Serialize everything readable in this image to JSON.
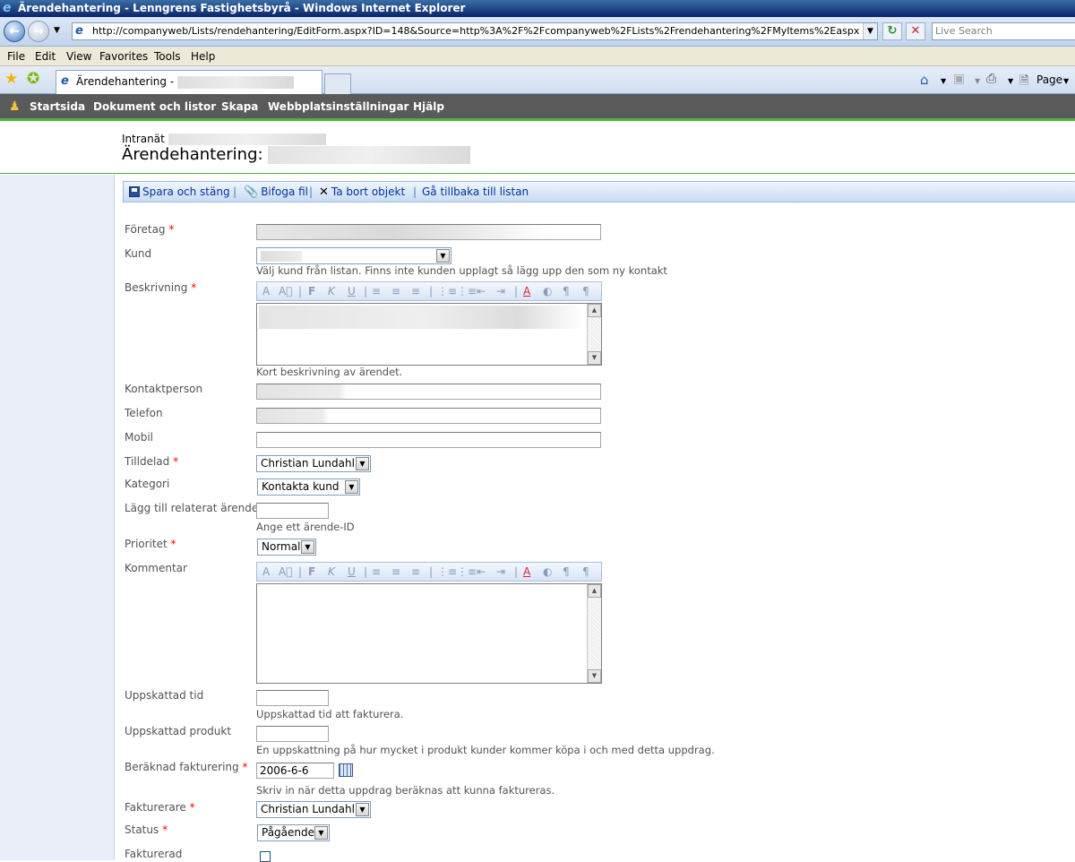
{
  "window": {
    "title": "Ärendehantering - Lenngrens Fastighetsbyrå - Windows Internet Explorer",
    "url": "http://companyweb/Lists/rendehantering/EditForm.aspx?ID=148&Source=http%3A%2F%2Fcompanyweb%2FLists%2Frendehantering%2FMyItems%2Easpx",
    "search_placeholder": "Live Search"
  },
  "menu": [
    "File",
    "Edit",
    "View",
    "Favorites",
    "Tools",
    "Help"
  ],
  "tab": {
    "label": "Ärendehantering -"
  },
  "commandbar": {
    "page_label": "Page"
  },
  "topnav": [
    "Startsida",
    "Dokument och listor",
    "Skapa",
    "Webbplatsinställningar",
    "Hjälp"
  ],
  "header": {
    "breadcrumb": "Intranät",
    "title": "Ärendehantering:"
  },
  "toolbar": {
    "save": "Spara och stäng",
    "attach": "Bifoga fil",
    "delete": "Ta bort objekt",
    "back": "Gå tillbaka till listan",
    "sep": "|"
  },
  "form": {
    "required_mark": "*",
    "foretag": {
      "label": "Företag"
    },
    "kund": {
      "label": "Kund",
      "hint": "Välj kund från listan. Finns inte kunden upplagt så lägg upp den som ny kontakt"
    },
    "beskrivning": {
      "label": "Beskrivning",
      "hint": "Kort beskrivning av ärendet."
    },
    "kontaktperson": {
      "label": "Kontaktperson"
    },
    "telefon": {
      "label": "Telefon"
    },
    "mobil": {
      "label": "Mobil",
      "value": ""
    },
    "tilldelad": {
      "label": "Tilldelad",
      "value": "Christian Lundahl"
    },
    "kategori": {
      "label": "Kategori",
      "value": "Kontakta kund"
    },
    "relaterat": {
      "label": "Lägg till relaterat ärende",
      "value": "",
      "hint": "Ange ett ärende-ID"
    },
    "prioritet": {
      "label": "Prioritet",
      "value": "Normal"
    },
    "kommentar": {
      "label": "Kommentar"
    },
    "uppskattad_tid": {
      "label": "Uppskattad tid",
      "value": "",
      "hint": "Uppskattad tid att fakturera."
    },
    "uppskattad_produkt": {
      "label": "Uppskattad produkt",
      "value": "",
      "hint": "En uppskattning på hur mycket i produkt kunder kommer köpa i och med detta uppdrag."
    },
    "beraknad": {
      "label": "Beräknad fakturering",
      "value": "2006-6-6",
      "hint": "Skriv in när detta uppdrag beräknas att kunna faktureras."
    },
    "fakturerare": {
      "label": "Fakturerare",
      "value": "Christian Lundahl"
    },
    "status": {
      "label": "Status",
      "value": "Pågående"
    },
    "fakturerad": {
      "label": "Fakturerad"
    }
  },
  "rte_buttons": [
    "A",
    "A⃝",
    "|",
    "F",
    "K",
    "U",
    "|",
    "≡",
    "≡",
    "≡",
    "|",
    "⋮≡",
    "⋮≡",
    "⇤",
    "⇥",
    "|",
    "A",
    "◐",
    "¶",
    "¶"
  ]
}
